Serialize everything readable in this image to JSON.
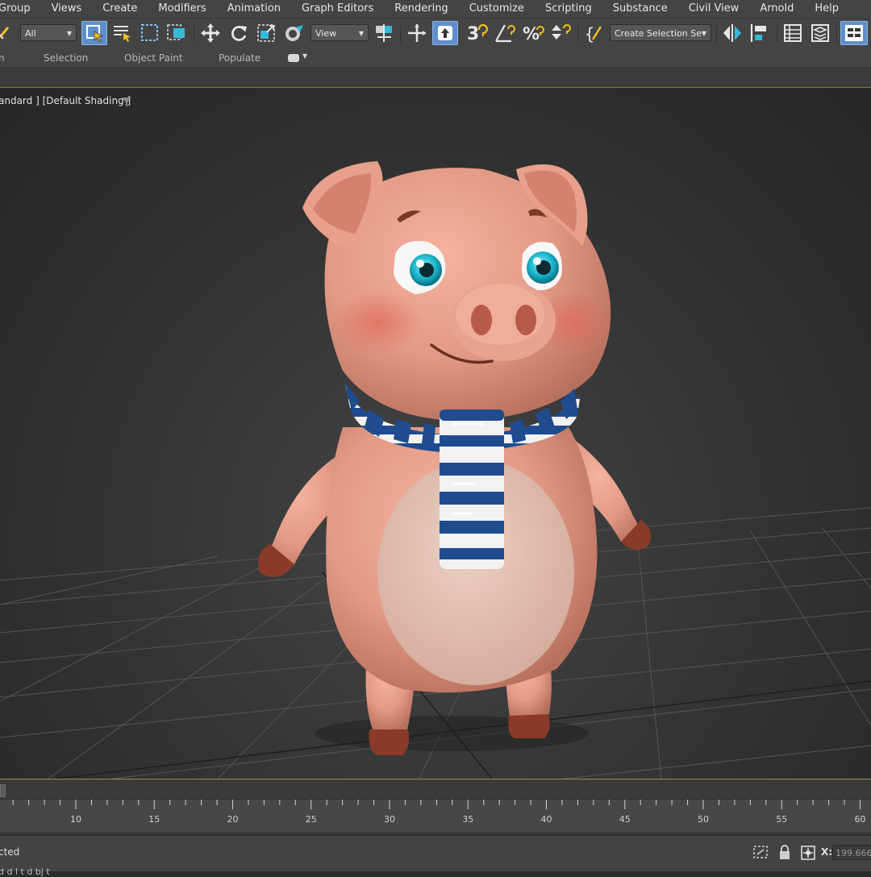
{
  "menu": [
    "Group",
    "Views",
    "Create",
    "Modifiers",
    "Animation",
    "Graph Editors",
    "Rendering",
    "Customize",
    "Scripting",
    "Substance",
    "Civil View",
    "Arnold",
    "Help"
  ],
  "toolbar": {
    "filter_dropdown": "All",
    "coord_dropdown": "View",
    "selection_set_dropdown": "Create Selection Se"
  },
  "ribbon": {
    "tabs": [
      "n",
      "Selection",
      "Object Paint",
      "Populate"
    ]
  },
  "viewport": {
    "label": "andard ] [Default Shading ]"
  },
  "timeline": {
    "ticks": [
      "10",
      "15",
      "20",
      "25",
      "30",
      "35",
      "40",
      "45",
      "50",
      "55",
      "60"
    ]
  },
  "status": {
    "text": "cted",
    "subtext": "d d    l  t   d  bj  t",
    "x_label": "X:",
    "x_value": "199.666"
  },
  "colors": {
    "ui_background": "#444444",
    "active_button": "#5f8fc8",
    "viewport_border": "#a08a3a"
  }
}
